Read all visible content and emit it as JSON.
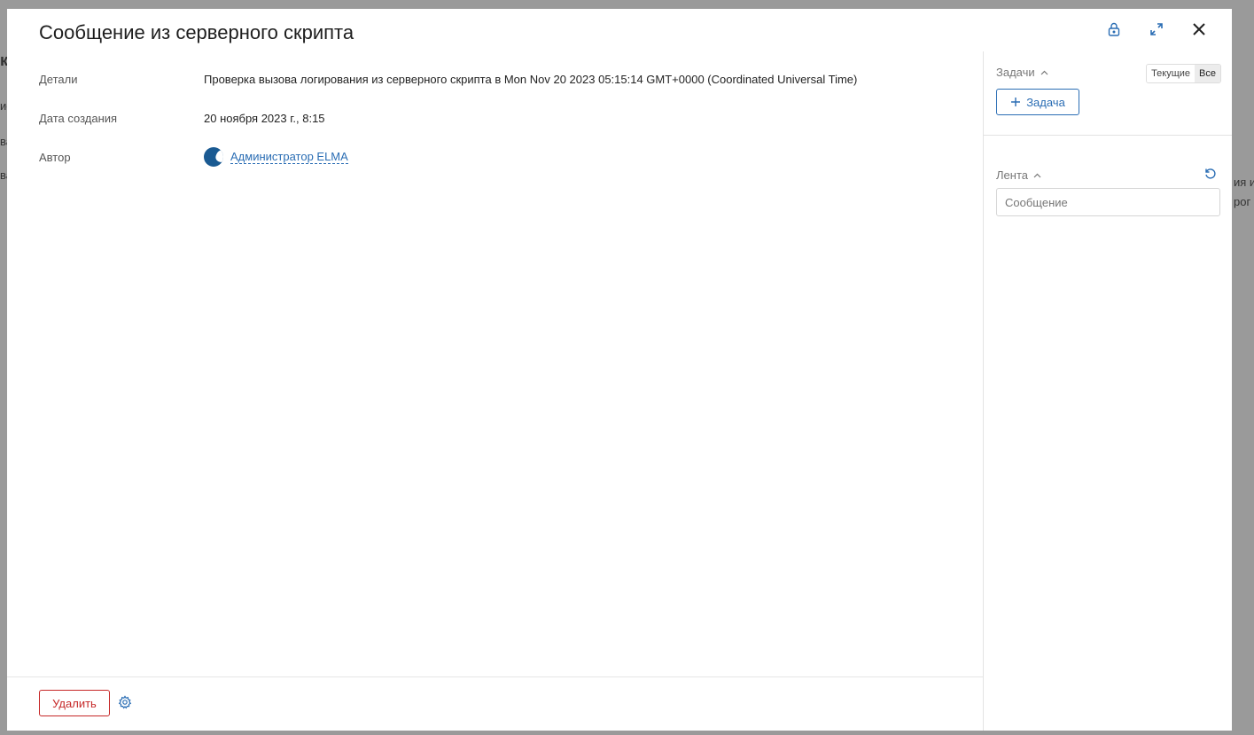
{
  "background": {
    "left_fragments": [
      "ки",
      "ие",
      "ва",
      "ва"
    ],
    "right_fragments": [
      "ия и",
      "рог"
    ]
  },
  "modal": {
    "title": "Сообщение из серверного скрипта",
    "header_icons": [
      "lock-icon",
      "expand-icon",
      "close-icon"
    ]
  },
  "fields": [
    {
      "label": "Детали",
      "value": "Проверка вызова логирования из серверного скрипта в Mon Nov 20 2023 05:15:14 GMT+0000 (Coordinated Universal Time)"
    },
    {
      "label": "Дата создания",
      "value": "20 ноября 2023 г., 8:15"
    },
    {
      "label": "Автор",
      "value": "Администратор ELMA"
    }
  ],
  "footer": {
    "delete_label": "Удалить"
  },
  "tasks": {
    "title": "Задачи",
    "filter_current": "Текущие",
    "filter_all": "Все",
    "add_task_label": "Задача"
  },
  "feed": {
    "title": "Лента",
    "input_placeholder": "Сообщение"
  },
  "colors": {
    "accent": "#2a6db4",
    "danger": "#c62828",
    "overlay": "#7d7d7d"
  }
}
